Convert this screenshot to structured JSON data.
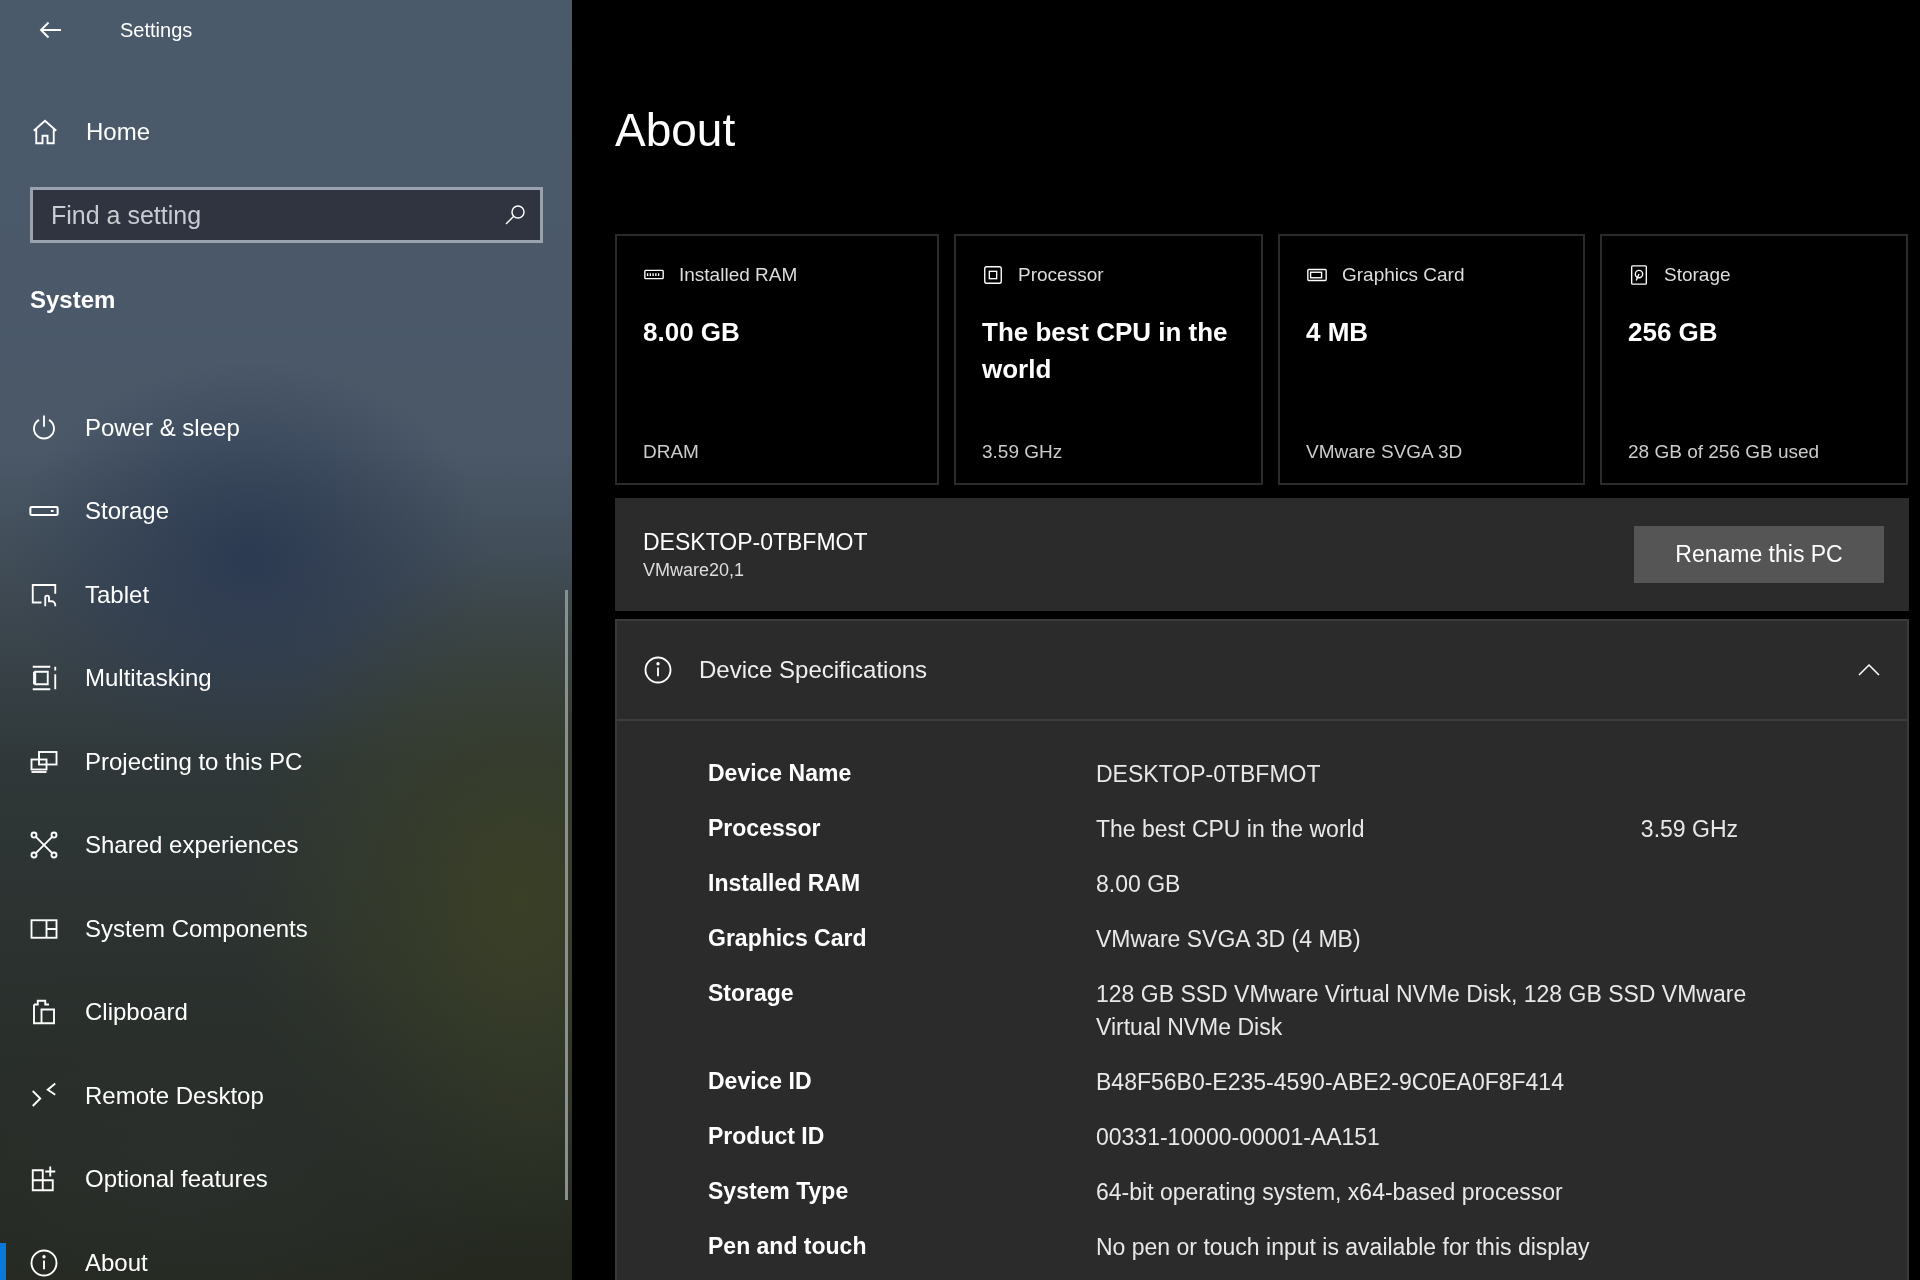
{
  "window": {
    "title": "Settings"
  },
  "sidebar": {
    "home": "Home",
    "search": {
      "placeholder": "Find a setting"
    },
    "section": "System",
    "items": [
      {
        "label": "Power & sleep",
        "selected": false
      },
      {
        "label": "Storage",
        "selected": false
      },
      {
        "label": "Tablet",
        "selected": false
      },
      {
        "label": "Multitasking",
        "selected": false
      },
      {
        "label": "Projecting to this PC",
        "selected": false
      },
      {
        "label": "Shared experiences",
        "selected": false
      },
      {
        "label": "System Components",
        "selected": false
      },
      {
        "label": "Clipboard",
        "selected": false
      },
      {
        "label": "Remote Desktop",
        "selected": false
      },
      {
        "label": "Optional features",
        "selected": false
      },
      {
        "label": "About",
        "selected": true
      }
    ]
  },
  "page": {
    "title": "About",
    "cards": [
      {
        "label": "Installed RAM",
        "value": "8.00 GB",
        "detail": "DRAM"
      },
      {
        "label": "Processor",
        "value": "The best CPU in the world",
        "detail": "3.59 GHz"
      },
      {
        "label": "Graphics Card",
        "value": "4 MB",
        "detail": "VMware SVGA 3D"
      },
      {
        "label": "Storage",
        "value": "256 GB",
        "detail": "28 GB of 256 GB used"
      }
    ],
    "pc": {
      "name": "DESKTOP-0TBFMOT",
      "model": "VMware20,1",
      "button": "Rename this PC"
    },
    "specs": {
      "title": "Device Specifications",
      "expanded": true,
      "rows": [
        {
          "label": "Device Name",
          "values": [
            "DESKTOP-0TBFMOT"
          ]
        },
        {
          "label": "Processor",
          "values": [
            "The best CPU in the world",
            "3.59 GHz"
          ]
        },
        {
          "label": "Installed RAM",
          "values": [
            "8.00 GB"
          ]
        },
        {
          "label": "Graphics Card",
          "values": [
            "VMware SVGA 3D (4 MB)"
          ]
        },
        {
          "label": "Storage",
          "values": [
            "128 GB SSD VMware Virtual NVMe Disk, 128 GB SSD VMware Virtual NVMe Disk"
          ]
        },
        {
          "label": "Device ID",
          "values": [
            "B48F56B0-E235-4590-ABE2-9C0EA0F8F414"
          ]
        },
        {
          "label": "Product ID",
          "values": [
            "00331-10000-00001-AA151"
          ]
        },
        {
          "label": "System Type",
          "values": [
            "64-bit operating system, x64-based processor"
          ]
        },
        {
          "label": "Pen and touch",
          "values": [
            "No pen or touch input is available for this display"
          ]
        }
      ]
    }
  }
}
